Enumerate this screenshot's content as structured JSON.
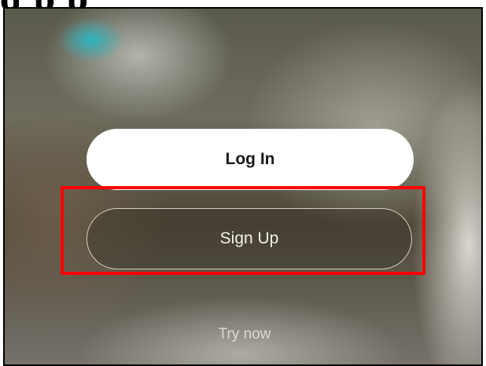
{
  "caption_partial": "g   p                          p",
  "buttons": {
    "login_label": "Log In",
    "signup_label": "Sign Up",
    "try_now_label": "Try now"
  },
  "colors": {
    "highlight": "#ff0000",
    "login_bg": "#ffffff"
  }
}
